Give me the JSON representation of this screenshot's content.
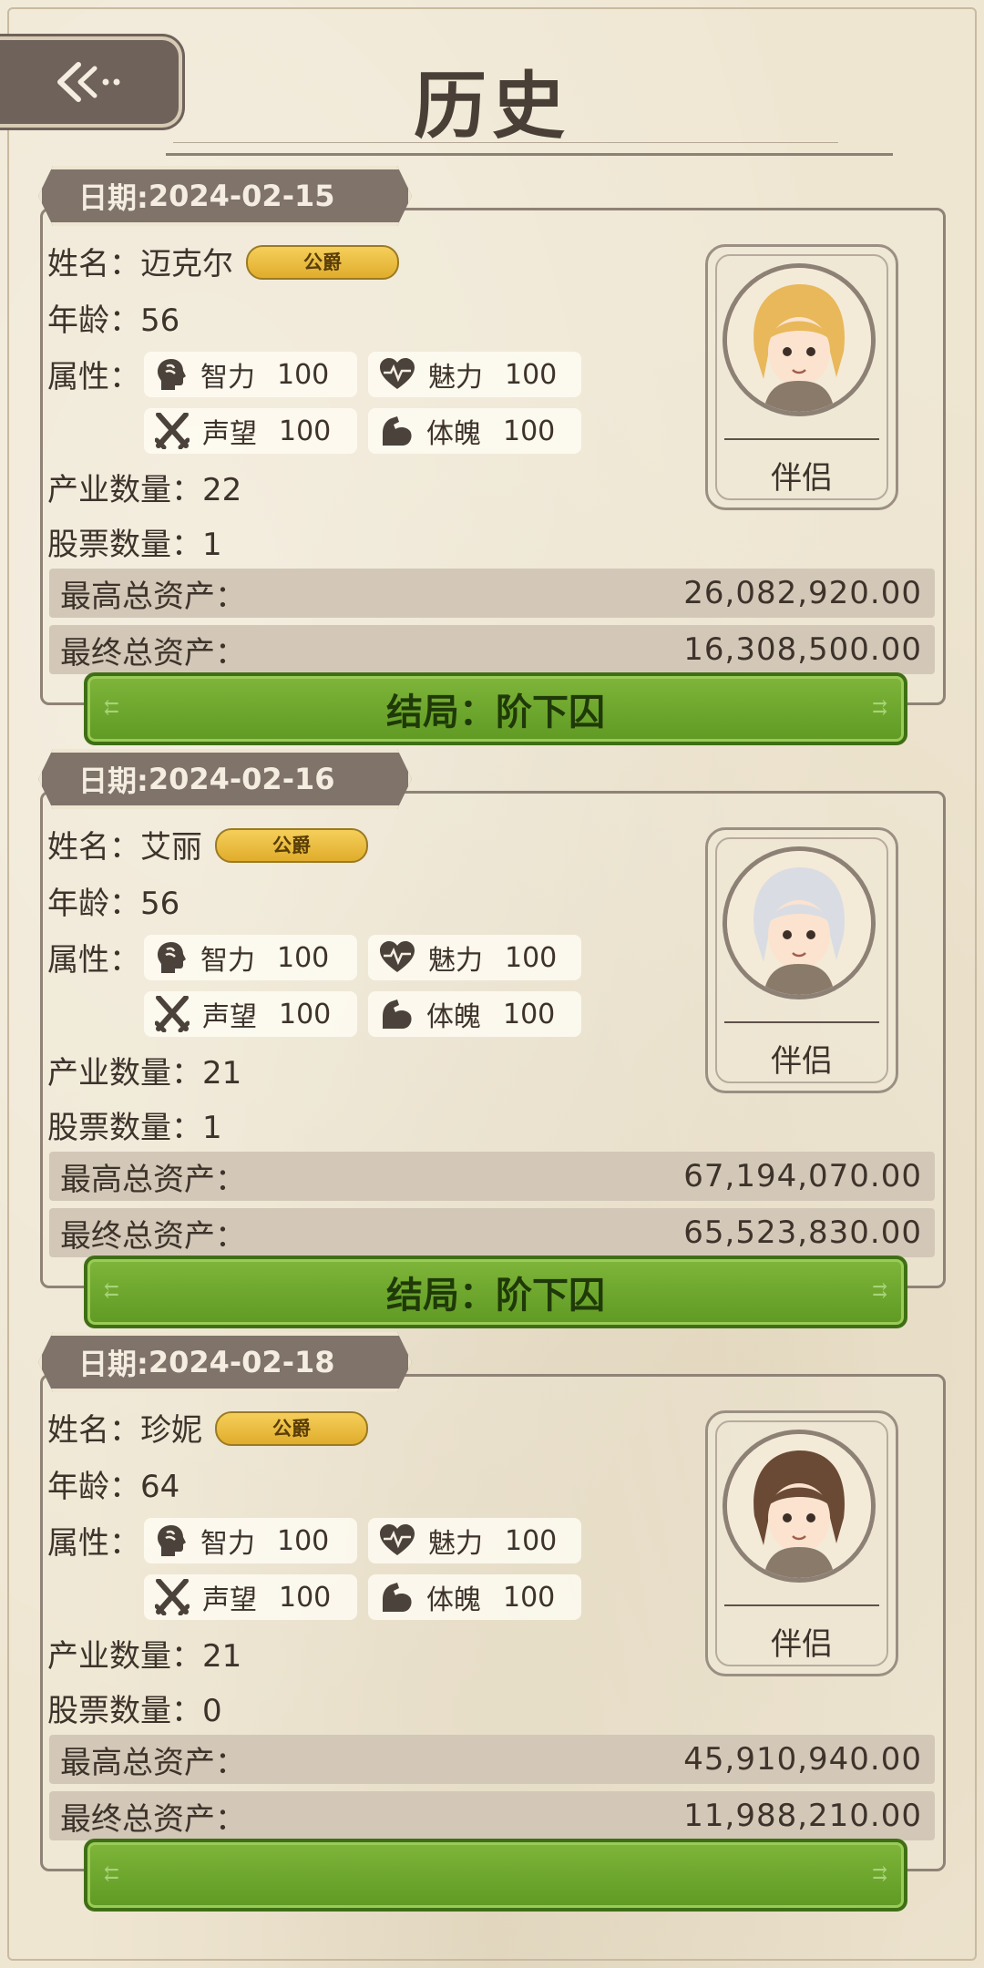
{
  "header": {
    "title": "历史"
  },
  "labels": {
    "name": "姓名：",
    "age": "年龄：",
    "attributes": "属性：",
    "industry": "产业数量：",
    "stocks": "股票数量：",
    "max_assets": "最高总资产：",
    "final_assets": "最终总资产：",
    "partner": "伴侣",
    "date_prefix": "日期: "
  },
  "attr_names": {
    "int": "智力",
    "charm": "魅力",
    "fame": "声望",
    "phys": "体魄"
  },
  "records": [
    {
      "date": "2024-02-15",
      "name": "迈克尔",
      "title": "公爵",
      "age": "56",
      "attrs": {
        "int": "100",
        "charm": "100",
        "fame": "100",
        "phys": "100"
      },
      "industry": "22",
      "stocks": "1",
      "max_assets": "26,082,920.00",
      "final_assets": "16,308,500.00",
      "ending": "结局：阶下囚",
      "hair": "#e8b85a"
    },
    {
      "date": "2024-02-16",
      "name": "艾丽",
      "title": "公爵",
      "age": "56",
      "attrs": {
        "int": "100",
        "charm": "100",
        "fame": "100",
        "phys": "100"
      },
      "industry": "21",
      "stocks": "1",
      "max_assets": "67,194,070.00",
      "final_assets": "65,523,830.00",
      "ending": "结局：阶下囚",
      "hair": "#d9dde3"
    },
    {
      "date": "2024-02-18",
      "name": "珍妮",
      "title": "公爵",
      "age": "64",
      "attrs": {
        "int": "100",
        "charm": "100",
        "fame": "100",
        "phys": "100"
      },
      "industry": "21",
      "stocks": "0",
      "max_assets": "45,910,940.00",
      "final_assets": "11,988,210.00",
      "ending": "",
      "hair": "#6b4a35"
    }
  ]
}
